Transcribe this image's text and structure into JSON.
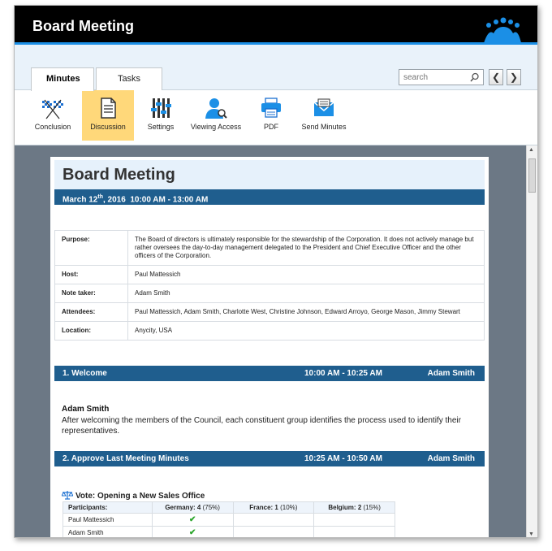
{
  "app": {
    "title": "Board Meeting"
  },
  "tabs": [
    {
      "label": "Minutes",
      "active": true
    },
    {
      "label": "Tasks",
      "active": false
    }
  ],
  "search": {
    "placeholder": "search",
    "prev": "❮",
    "next": "❯"
  },
  "toolbar": {
    "items": [
      {
        "label": "Conclusion",
        "icon": "checkered-flags-icon"
      },
      {
        "label": "Discussion",
        "icon": "document-icon",
        "active": true
      },
      {
        "label": "Settings",
        "icon": "sliders-icon"
      },
      {
        "label": "Viewing Access",
        "icon": "user-search-icon"
      },
      {
        "label": "PDF",
        "icon": "printer-icon"
      },
      {
        "label": "Send Minutes",
        "icon": "envelope-icon"
      }
    ]
  },
  "document": {
    "title": "Board Meeting",
    "date_main": "March 12",
    "date_sup": "th",
    "date_rest": ", 2016  10:00 AM - 13:00 AM",
    "info": [
      {
        "key": "Purpose:",
        "value": "The Board of directors is ultimately responsible for the stewardship of the Corporation. It does not actively manage but rather oversees the day-to-day management delegated to the President and Chief Executive Officer and the other officers of the Corporation."
      },
      {
        "key": "Host:",
        "value": "Paul Mattessich"
      },
      {
        "key": "Note taker:",
        "value": "Adam Smith"
      },
      {
        "key": "Attendees:",
        "value": "Paul Mattessich, Adam Smith, Charlotte West, Christine Johnson, Edward Arroyo, George Mason, Jimmy Stewart"
      },
      {
        "key": "Location:",
        "value": "Anycity, USA"
      }
    ],
    "agenda": [
      {
        "title": "1. Welcome",
        "time": "10:00 AM - 10:25 AM",
        "owner": "Adam Smith"
      },
      {
        "title": "2. Approve Last Meeting Minutes",
        "time": "10:25 AM - 10:50 AM",
        "owner": "Adam Smith"
      }
    ],
    "welcome": {
      "speaker": "Adam Smith",
      "text": "After welcoming the members of the Council, each constituent group identifies the process used to identify their representatives."
    },
    "vote": {
      "title": "Vote: Opening a New Sales Office",
      "header": {
        "participants": "Participants:",
        "germany": "Germany:",
        "germany_count": "4",
        "germany_pct": "(75%)",
        "france": "France:",
        "france_count": "1",
        "france_pct": "(10%)",
        "belgium": "Belgium:",
        "belgium_count": "2",
        "belgium_pct": "(15%)"
      },
      "rows": [
        {
          "name": "Paul Mattessich",
          "germany": "✔",
          "france": "",
          "belgium": ""
        },
        {
          "name": "Adam Smith",
          "germany": "✔",
          "france": "",
          "belgium": ""
        }
      ]
    }
  },
  "colors": {
    "titlebar": "#000000",
    "accent": "#1b8fe6",
    "section_bar": "#1f5e8e",
    "active_tool": "#ffd87a",
    "check": "#2aa52a"
  }
}
